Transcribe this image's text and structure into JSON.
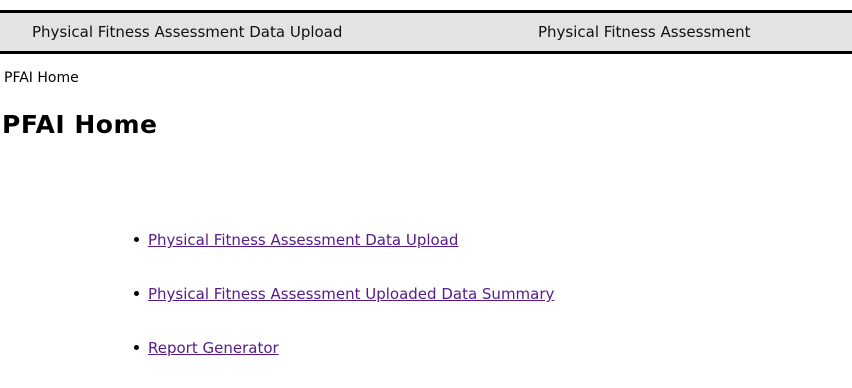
{
  "nav": {
    "items": [
      {
        "label": "Physical Fitness Assessment Data Upload"
      },
      {
        "label": "Physical Fitness Assessment"
      }
    ]
  },
  "breadcrumb": "PFAI Home",
  "page_title": "PFAI Home",
  "links": [
    {
      "label": "Physical Fitness Assessment Data Upload"
    },
    {
      "label": "Physical Fitness Assessment Uploaded Data Summary"
    },
    {
      "label": "Report Generator"
    }
  ],
  "colors": {
    "nav_background": "#e3e3e3",
    "visited_link": "#551a8b"
  }
}
